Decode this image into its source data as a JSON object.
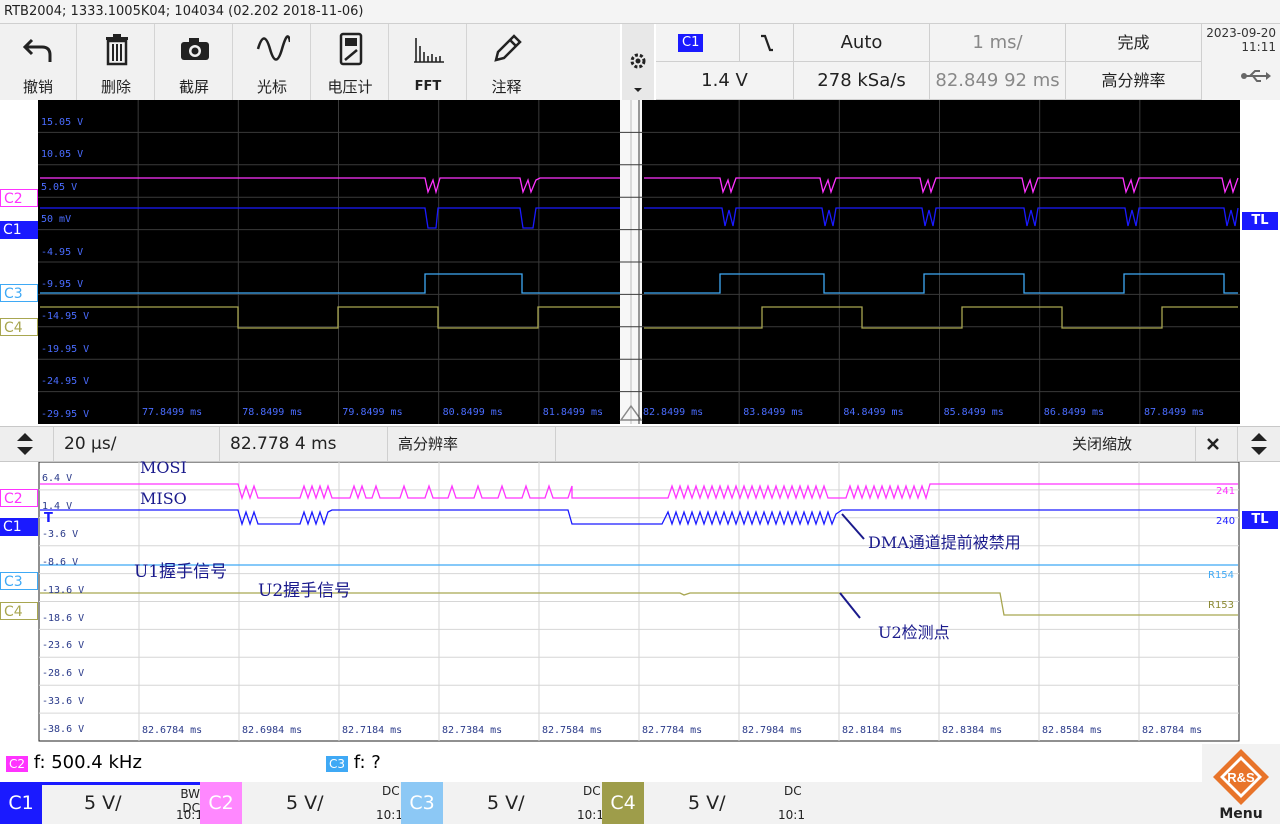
{
  "title": "RTB2004; 1333.1005K04; 104034 (02.202 2018-11-06)",
  "toolbar": {
    "undo": "撤销",
    "delete": "删除",
    "screenshot": "截屏",
    "cursor": "光标",
    "voltmeter": "电压计",
    "fft": "FFT",
    "annotate": "注释"
  },
  "settings": {
    "trigger_channel": "C1",
    "trigger_level": "1.4 V",
    "trigger_mode": "Auto",
    "sample_rate": "278 kSa/s",
    "timebase": "1 ms/",
    "trigger_position": "82.849 92 ms",
    "status": "完成",
    "acq_mode": "高分辨率"
  },
  "clock": {
    "date": "2023-09-20",
    "time": "11:11"
  },
  "upper": {
    "y_labels": [
      "15.05 V",
      "10.05 V",
      "5.05 V",
      "50 mV",
      "-4.95 V",
      "-9.95 V",
      "-14.95 V",
      "-19.95 V",
      "-24.95 V",
      "-29.95 V"
    ],
    "x_labels": [
      "77.8499 ms",
      "78.8499 ms",
      "79.8499 ms",
      "80.8499 ms",
      "81.8499 ms",
      "82.8499 ms",
      "83.8499 ms",
      "84.8499 ms",
      "85.8499 ms",
      "86.8499 ms",
      "87.8499 ms"
    ],
    "channels": [
      "C2",
      "C1",
      "C3",
      "C4"
    ],
    "trigger_tag": "TL"
  },
  "zoombar": {
    "timebase": "20 µs/",
    "position": "82.778 4 ms",
    "acq_mode": "高分辨率",
    "close": "关闭缩放"
  },
  "lower": {
    "y_labels": [
      "6.4 V",
      "1.4 V",
      "-3.6 V",
      "-8.6 V",
      "-13.6 V",
      "-18.6 V",
      "-23.6 V",
      "-28.6 V",
      "-33.6 V",
      "-38.6 V"
    ],
    "x_labels": [
      "82.6784 ms",
      "82.6984 ms",
      "82.7184 ms",
      "82.7384 ms",
      "82.7584 ms",
      "82.7784 ms",
      "82.7984 ms",
      "82.8184 ms",
      "82.8384 ms",
      "82.8584 ms",
      "82.8784 ms"
    ],
    "channels": [
      "C2",
      "C1",
      "C3",
      "C4"
    ],
    "trigger_marker": "T",
    "trigger_tag": "TL",
    "right_labels": [
      "241",
      "240",
      "R154",
      "R153"
    ],
    "annotations": {
      "mosi": "MOSI",
      "miso": "MISO",
      "u1": "U1握手信号",
      "u2": "U2握手信号",
      "dma": "DMA通道提前被禁用",
      "u2check": "U2检测点"
    }
  },
  "measurements": [
    {
      "channel": "C2",
      "text": "f: 500.4 kHz"
    },
    {
      "channel": "C3",
      "text": "f: ?"
    }
  ],
  "channel_bar": [
    {
      "name": "C1",
      "scale": "5 V/",
      "coupling": "DC",
      "bw": "BW",
      "ratio": "10:1",
      "color": "#1a1aff"
    },
    {
      "name": "C2",
      "scale": "5 V/",
      "coupling": "DC",
      "bw": "",
      "ratio": "10:1",
      "color": "#ff33ff"
    },
    {
      "name": "C3",
      "scale": "5 V/",
      "coupling": "DC",
      "bw": "",
      "ratio": "10:1",
      "color": "#3fa9f5"
    },
    {
      "name": "C4",
      "scale": "5 V/",
      "coupling": "DC",
      "bw": "",
      "ratio": "10:1",
      "color": "#9e9d4a"
    }
  ],
  "menu": {
    "label": "Menu",
    "logo": "R&S"
  },
  "colors": {
    "c1": "#1a1aff",
    "c2": "#ff33ff",
    "c3": "#3fa9f5",
    "c4": "#a8a650"
  }
}
